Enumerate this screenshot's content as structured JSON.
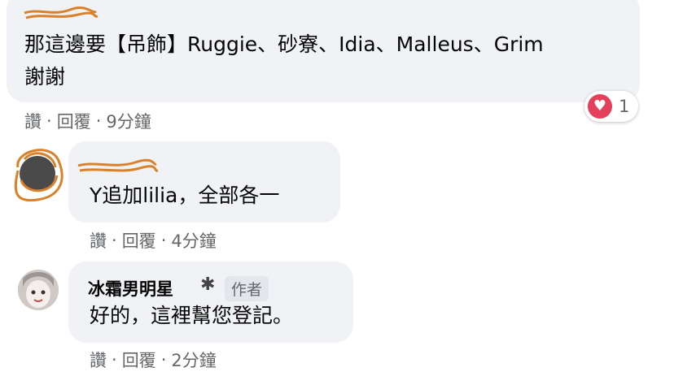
{
  "comments": [
    {
      "text_line1": "那這邊要【吊飾】Ruggie、砂寮、Idia、Malleus、Grim",
      "text_line2": "謝謝",
      "actions": {
        "like": "讚",
        "reply": "回覆",
        "time": "9分鐘"
      },
      "reaction": {
        "icon": "heart-icon",
        "count": "1"
      }
    },
    {
      "text": "Y追加lilia，全部各一",
      "actions": {
        "like": "讚",
        "reply": "回覆",
        "time": "4分鐘"
      }
    },
    {
      "author": "冰霜男明星",
      "badge": "作者",
      "text": "好的，這裡幫您登記。",
      "actions": {
        "like": "讚",
        "reply": "回覆",
        "time": "2分鐘"
      }
    }
  ],
  "colors": {
    "bubble": "#f0f2f5",
    "meta": "#65676b",
    "scribble": "#d9822b",
    "heart": "#e4405b"
  }
}
